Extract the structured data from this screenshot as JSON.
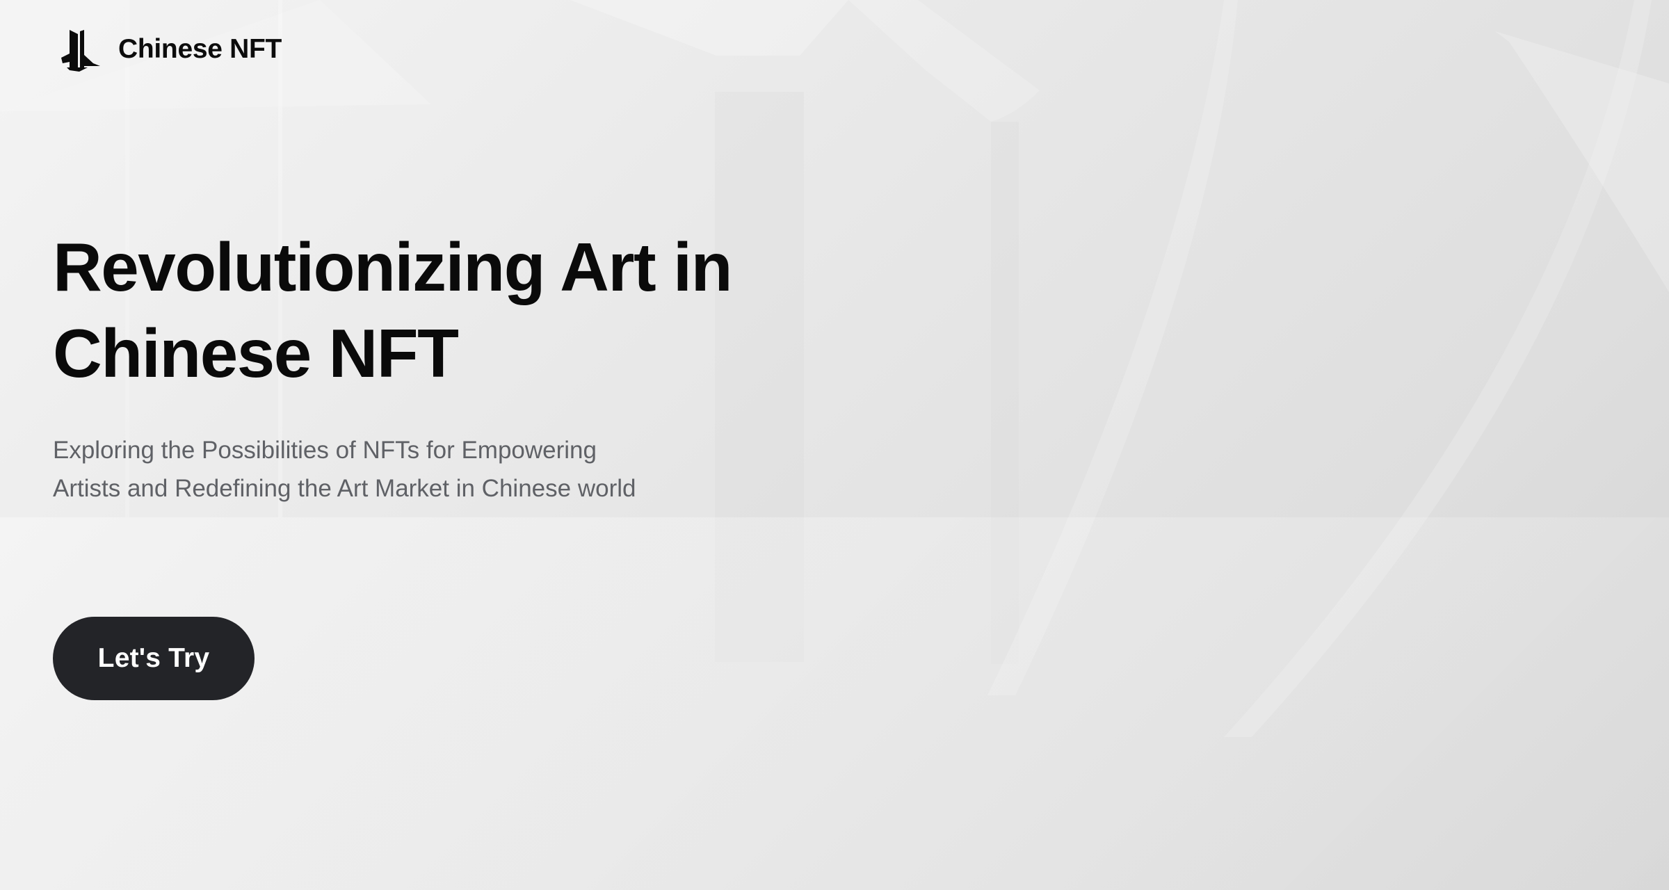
{
  "header": {
    "logo_icon": "chinese-building-logo-icon",
    "brand_name": "Chinese NFT"
  },
  "hero": {
    "title_line_1": "Revolutionizing Art in",
    "title_line_2": "Chinese NFT",
    "subtitle_line_1": "Exploring the Possibilities of NFTs for Empowering",
    "subtitle_line_2": "Artists and Redefining the Art Market in Chinese world",
    "cta_label": "Let's Try"
  },
  "colors": {
    "title": "#0a0a0a",
    "subtitle": "#5f6166",
    "button_bg": "#232428",
    "button_text": "#ffffff"
  }
}
